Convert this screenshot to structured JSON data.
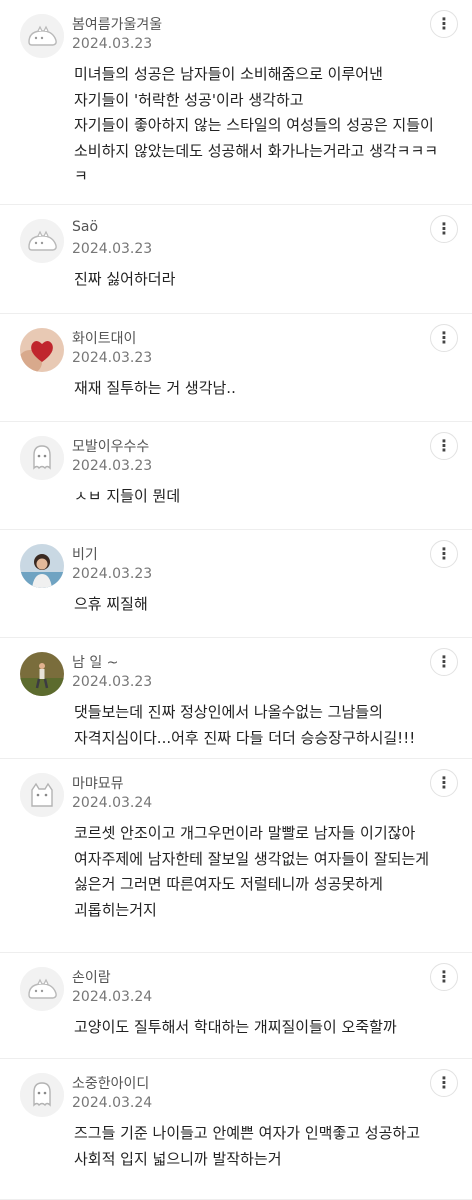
{
  "icons": {
    "more": "more-vertical-icon"
  },
  "comments": [
    {
      "author": "봄여름가울겨울",
      "date": "2024.03.23",
      "avatar": "default-dino",
      "body": "미녀들의 성공은 남자들이 소비해줌으로 이루어낸\n자기들이 '허락한 성공'이라 생각하고\n자기들이 좋아하지 않는 스타일의 여성들의 성공은 지들이 소비하지 않았는데도 성공해서 화가나는거라고 생각ㅋㅋㅋㅋ"
    },
    {
      "author": "Saö",
      "date": "2024.03.23",
      "avatar": "default-dino",
      "body": "진짜 싫어하더라"
    },
    {
      "author": "화이트대이",
      "date": "2024.03.23",
      "avatar": "heart-photo",
      "body": "재재 질투하는 거 생각남.."
    },
    {
      "author": "모발이우수수",
      "date": "2024.03.23",
      "avatar": "default-ghost",
      "body": "ㅅㅂ 지들이 뭔데"
    },
    {
      "author": "비기",
      "date": "2024.03.23",
      "avatar": "person-photo",
      "body": "으휴 찌질해"
    },
    {
      "author": "남 일 ~",
      "date": "2024.03.23",
      "avatar": "outdoor-photo",
      "body": "댓들보는데 진짜 정상인에서 나올수없는 그남들의\n자격지심이다...어후 진짜 다들 더더 승승장구하시길!!!"
    },
    {
      "author": "마먀묘뮤",
      "date": "2024.03.24",
      "avatar": "default-cat",
      "body": "코르셋 안조이고 개그우먼이라 말빨로 남자들 이기잖아\n여자주제에 남자한테 잘보일 생각없는 여자들이 잘되는게\n싫은거 그러면 따른여자도 저럴테니까 성공못하게\n괴롭히는거지"
    },
    {
      "author": "손이람",
      "date": "2024.03.24",
      "avatar": "default-dino",
      "body": "고양이도 질투해서 학대하는 개찌질이들이 오죽할까"
    },
    {
      "author": "소중한아이디",
      "date": "2024.03.24",
      "avatar": "default-ghost",
      "body": "즈그들 기준 나이들고 안예쁜 여자가 인맥좋고 성공하고\n사회적 입지 넓으니까 발작하는거"
    }
  ]
}
